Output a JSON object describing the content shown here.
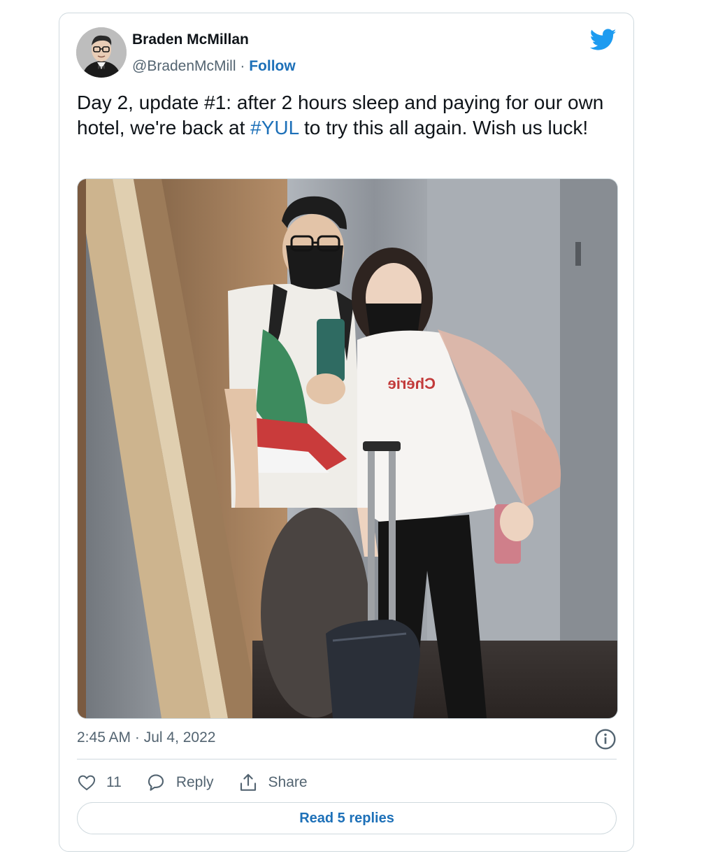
{
  "author": {
    "name": "Braden McMillan",
    "handle": "@BradenMcMill",
    "separator": "·",
    "follow_label": "Follow",
    "avatar_icon": "user-avatar-photo"
  },
  "brand": {
    "icon": "twitter-bird-icon",
    "color": "#1d9bf0"
  },
  "tweet": {
    "text_part1": "Day 2, update #1: after 2 hours sleep and paying for our own hotel, we're back at ",
    "hashtag": "#YUL",
    "text_part2": " to try this all again. Wish us luck!"
  },
  "media": {
    "shirt_text": "Chérie",
    "subject": "mirror-selfie-elevator-photo"
  },
  "meta": {
    "timestamp": "2:45 AM · Jul 4, 2022",
    "info_icon": "info-icon"
  },
  "actions": {
    "like_count": "11",
    "reply_label": "Reply",
    "share_label": "Share"
  },
  "replies_button": "Read 5 replies",
  "colors": {
    "link": "#1d70b8",
    "text": "#0f1419",
    "muted": "#536471",
    "border": "#cfd9de"
  }
}
